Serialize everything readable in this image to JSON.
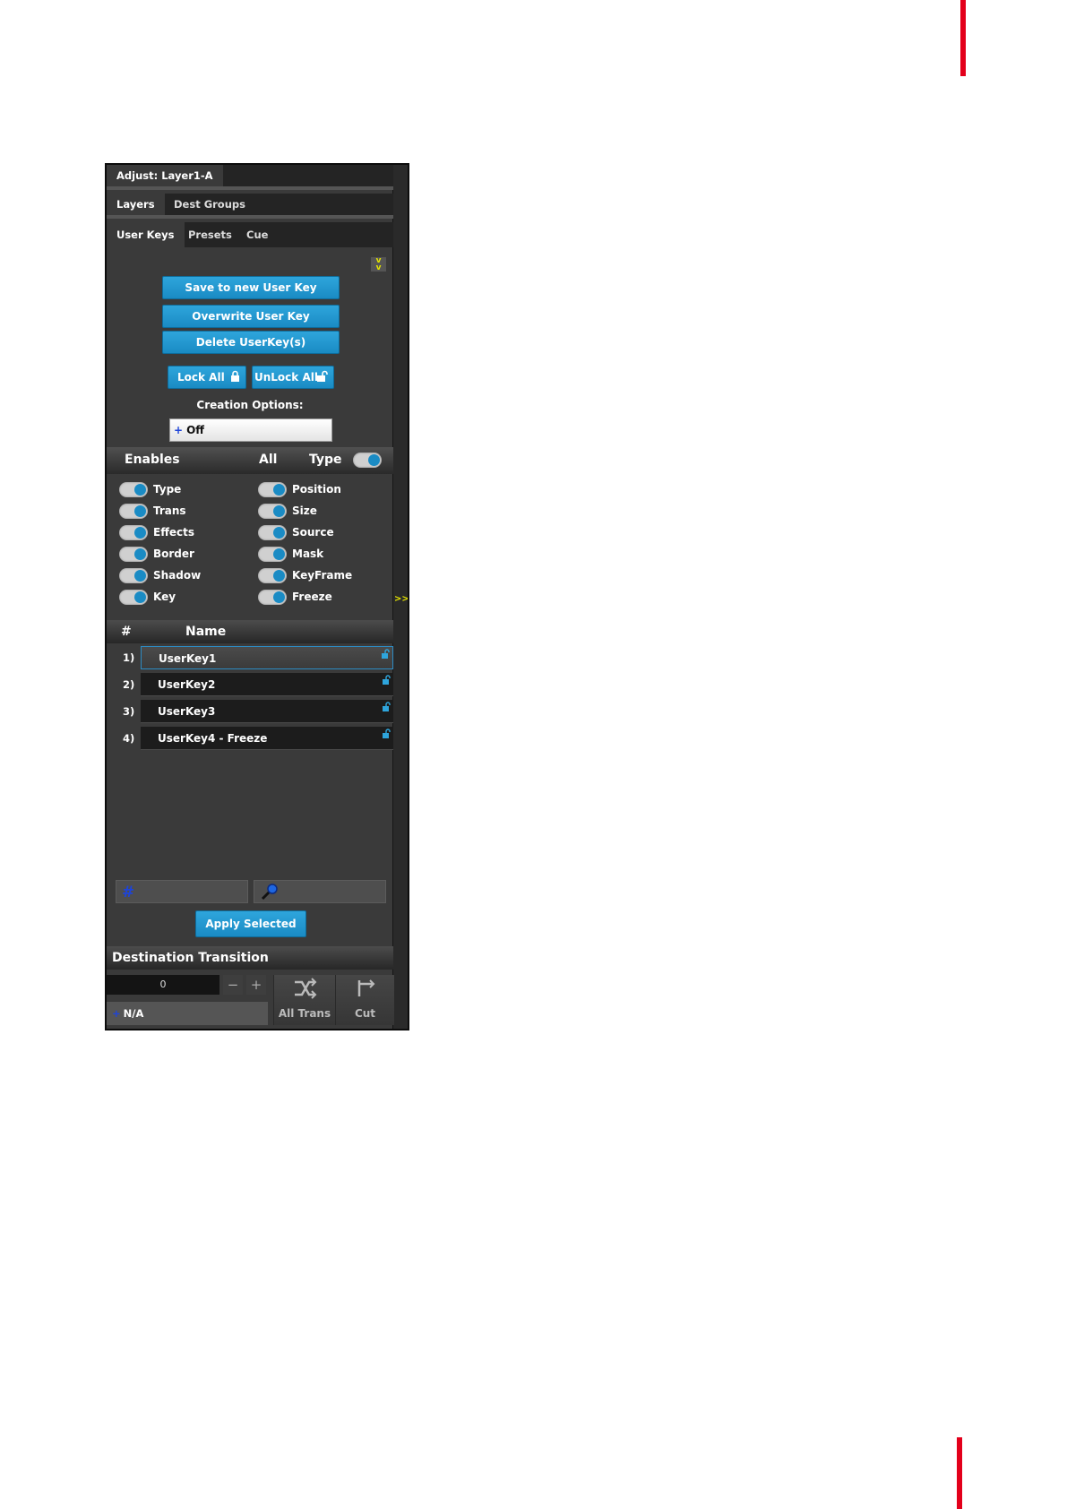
{
  "panel": {
    "title_tab": "Adjust: Layer1-A",
    "tabs_row1": [
      {
        "label": "Layers",
        "active": true
      },
      {
        "label": "Dest Groups",
        "active": false
      }
    ],
    "tabs_row2": [
      {
        "label": "User Keys",
        "active": true
      },
      {
        "label": "Presets",
        "active": false
      },
      {
        "label": "Cue",
        "active": false
      }
    ],
    "collapse_glyph": "v\nv",
    "expand_glyph": ">>"
  },
  "actions": {
    "save_new": "Save to new User Key",
    "overwrite": "Overwrite User Key",
    "delete": "Delete UserKey(s)",
    "lock_all": "Lock All",
    "unlock_all": "UnLock All",
    "creation_options_label": "Creation Options:",
    "creation_value_prefix": "+",
    "creation_value": "Off"
  },
  "enables": {
    "header": "Enables",
    "all_label": "All",
    "type_label": "Type",
    "type_on": true,
    "left": [
      {
        "label": "Type",
        "on": true
      },
      {
        "label": "Trans",
        "on": true
      },
      {
        "label": "Effects",
        "on": true
      },
      {
        "label": "Border",
        "on": true
      },
      {
        "label": "Shadow",
        "on": true
      },
      {
        "label": "Key",
        "on": true
      }
    ],
    "right": [
      {
        "label": "Position",
        "on": true
      },
      {
        "label": "Size",
        "on": true
      },
      {
        "label": "Source",
        "on": true
      },
      {
        "label": "Mask",
        "on": true
      },
      {
        "label": "KeyFrame",
        "on": true
      },
      {
        "label": "Freeze",
        "on": true
      }
    ]
  },
  "list": {
    "col_num": "#",
    "col_name": "Name",
    "rows": [
      {
        "num": "1)",
        "name": "UserKey1",
        "selected": true
      },
      {
        "num": "2)",
        "name": "UserKey2",
        "selected": false
      },
      {
        "num": "3)",
        "name": "UserKey3",
        "selected": false
      },
      {
        "num": "4)",
        "name": "UserKey4 - Freeze",
        "selected": false
      }
    ]
  },
  "footer": {
    "number_field_glyph": "#",
    "apply_selected": "Apply Selected"
  },
  "destination": {
    "header": "Destination Transition",
    "rate_value": "0",
    "minus": "−",
    "plus": "+",
    "transition_prefix": "+",
    "transition_value": "N/A",
    "all_trans": "All Trans",
    "cut": "Cut"
  },
  "colors": {
    "accent_blue": "#1a8bc4",
    "panel_bg": "#3a3a3a",
    "brand_red": "#e3001b"
  }
}
